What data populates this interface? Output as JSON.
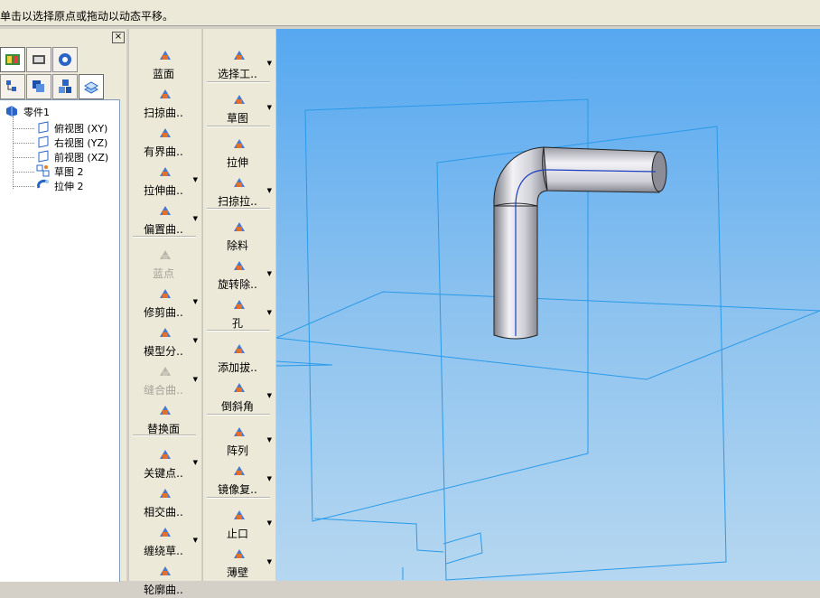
{
  "status": {
    "message": "单击以选择原点或拖动以动态平移。"
  },
  "left_panel": {
    "close_label": "×",
    "tree": [
      {
        "label": "零件1",
        "icon": "part-icon"
      },
      {
        "label": "俯视图 (XY)",
        "icon": "plane-icon"
      },
      {
        "label": "右视图 (YZ)",
        "icon": "plane-icon"
      },
      {
        "label": "前视图 (XZ)",
        "icon": "plane-icon"
      },
      {
        "label": "草图 2",
        "icon": "sketch-icon"
      },
      {
        "label": "拉伸 2",
        "icon": "extrude-icon"
      }
    ]
  },
  "surface_tools": [
    {
      "label": "蓝面",
      "icon": "blue-surface-icon",
      "enabled": true
    },
    {
      "label": "扫掠曲..",
      "icon": "swept-surface-icon",
      "enabled": true
    },
    {
      "label": "有界曲..",
      "icon": "bounded-surface-icon",
      "enabled": true
    },
    {
      "label": "拉伸曲..",
      "icon": "extruded-surface-icon",
      "enabled": true,
      "dropdown": true
    },
    {
      "label": "偏置曲..",
      "icon": "offset-surface-icon",
      "enabled": true,
      "dropdown": true
    },
    {
      "label": "蓝点",
      "icon": "blue-dot-icon",
      "enabled": false
    },
    {
      "label": "修剪曲..",
      "icon": "trim-surface-icon",
      "enabled": true,
      "dropdown": true
    },
    {
      "label": "模型分..",
      "icon": "split-model-icon",
      "enabled": true,
      "dropdown": true
    },
    {
      "label": "缝合曲..",
      "icon": "stitch-surface-icon",
      "enabled": false,
      "dropdown": true
    },
    {
      "label": "替换面",
      "icon": "replace-face-icon",
      "enabled": true
    },
    {
      "label": "关键点..",
      "icon": "keypoint-curve-icon",
      "enabled": true,
      "dropdown": true
    },
    {
      "label": "相交曲..",
      "icon": "intersect-curve-icon",
      "enabled": true
    },
    {
      "label": "缠绕草..",
      "icon": "wrap-sketch-icon",
      "enabled": true,
      "dropdown": true
    },
    {
      "label": "轮廓曲..",
      "icon": "contour-curve-icon",
      "enabled": true
    }
  ],
  "feature_tools": [
    {
      "label": "选择工..",
      "icon": "select-tool-icon",
      "dropdown": true
    },
    {
      "label": "草图",
      "icon": "sketch-tool-icon",
      "dropdown": true
    },
    {
      "label": "拉伸",
      "icon": "extrude-tool-icon"
    },
    {
      "label": "扫掠拉..",
      "icon": "sweep-extrude-icon",
      "dropdown": true
    },
    {
      "label": "除料",
      "icon": "cutout-icon"
    },
    {
      "label": "旋转除..",
      "icon": "revolve-cut-icon",
      "dropdown": true
    },
    {
      "label": "孔",
      "icon": "hole-icon",
      "dropdown": true
    },
    {
      "label": "添加拔..",
      "icon": "add-draft-icon"
    },
    {
      "label": "倒斜角",
      "icon": "chamfer-icon",
      "dropdown": true
    },
    {
      "label": "阵列",
      "icon": "pattern-icon",
      "dropdown": true
    },
    {
      "label": "镜像复..",
      "icon": "mirror-copy-icon",
      "dropdown": true
    },
    {
      "label": "止口",
      "icon": "lip-icon",
      "dropdown": true
    },
    {
      "label": "薄壁",
      "icon": "thin-wall-icon",
      "dropdown": true
    }
  ],
  "dropdown_glyph": "▼",
  "colors": {
    "viewport_top": "#56a8f0",
    "viewport_bottom": "#b6d7f0",
    "plane_edge": "#2a9ae8"
  }
}
